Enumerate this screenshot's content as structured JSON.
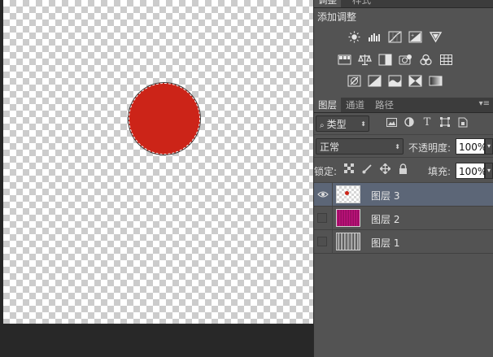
{
  "panel_top_tabs": [
    "调整",
    "样式"
  ],
  "adjustments": {
    "title": "添加调整",
    "row1": [
      "brightness-contrast-icon",
      "levels-icon",
      "curves-icon",
      "exposure-icon",
      "vibrance-icon"
    ],
    "row2": [
      "hue-saturation-icon",
      "color-balance-icon",
      "black-white-icon",
      "photo-filter-icon",
      "channel-mixer-icon",
      "color-lookup-icon"
    ],
    "row3": [
      "invert-icon",
      "posterize-icon",
      "threshold-icon",
      "selective-color-icon",
      "gradient-map-icon"
    ]
  },
  "layers_panel": {
    "tabs": [
      "图层",
      "通道",
      "路径"
    ],
    "filter_type_label": "类型",
    "blend_mode": "正常",
    "opacity_label": "不透明度:",
    "opacity_value": "100%",
    "lock_label": "锁定:",
    "fill_label": "填充:",
    "fill_value": "100%",
    "layers": [
      {
        "name": "图层 3",
        "visible": true,
        "selected": true
      },
      {
        "name": "图层 2",
        "visible": false,
        "selected": false
      },
      {
        "name": "图层 1",
        "visible": false,
        "selected": false
      }
    ]
  },
  "colors": {
    "circle": "#cc2418",
    "panel_bg": "#535353",
    "selected_row": "#5c6677"
  }
}
